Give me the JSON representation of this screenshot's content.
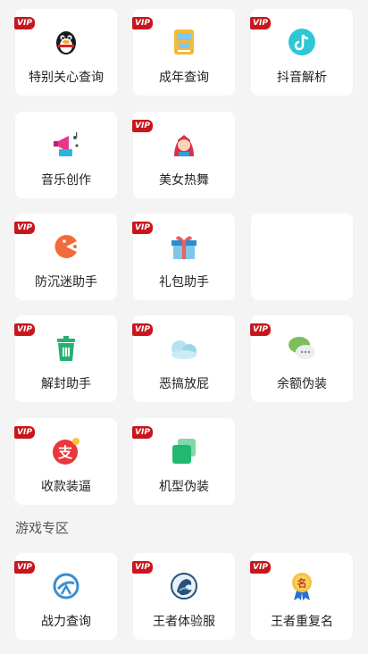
{
  "tools": [
    {
      "label": "特别关心查询",
      "vip": true,
      "icon": "penguin-icon"
    },
    {
      "label": "成年查询",
      "vip": true,
      "icon": "id-card-icon"
    },
    {
      "label": "抖音解析",
      "vip": true,
      "icon": "tiktok-icon"
    },
    {
      "label": "音乐创作",
      "vip": false,
      "icon": "music-megaphone-icon"
    },
    {
      "label": "美女热舞",
      "vip": true,
      "icon": "girl-avatar-icon"
    },
    {
      "label": "防沉迷助手",
      "vip": true,
      "icon": "pacman-icon"
    },
    {
      "label": "礼包助手",
      "vip": true,
      "icon": "gift-icon"
    },
    {
      "label": "",
      "vip": false,
      "icon": ""
    },
    {
      "label": "解封助手",
      "vip": true,
      "icon": "trash-bin-icon"
    },
    {
      "label": "恶搞放屁",
      "vip": true,
      "icon": "cloud-icon"
    },
    {
      "label": "余额伪装",
      "vip": true,
      "icon": "chat-bubbles-icon"
    },
    {
      "label": "收款装逼",
      "vip": true,
      "icon": "alipay-icon"
    },
    {
      "label": "机型伪装",
      "vip": true,
      "icon": "layered-squares-icon"
    }
  ],
  "section_title": "游戏专区",
  "games": [
    {
      "label": "战力查询",
      "vip": true,
      "icon": "compass-icon"
    },
    {
      "label": "王者体验服",
      "vip": true,
      "icon": "dragon-emblem-icon"
    },
    {
      "label": "王者重复名",
      "vip": true,
      "icon": "name-medal-icon"
    }
  ],
  "vip_text": "VIP",
  "colors": {
    "vip": "#c8161d",
    "card": "#ffffff",
    "background": "#f4f4f4"
  }
}
